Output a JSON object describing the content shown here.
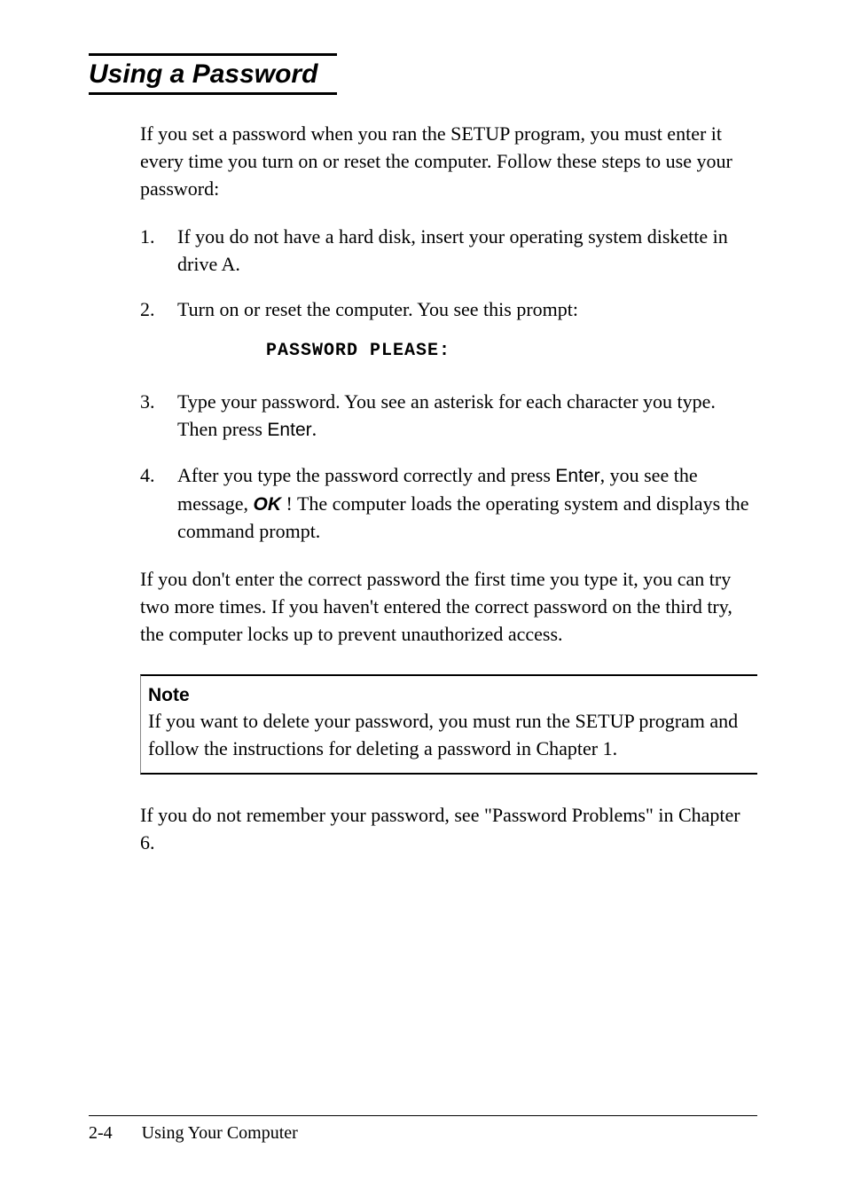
{
  "heading": "Using a Password",
  "intro": "If you set a password when you ran the SETUP program, you must enter it every time you turn on or reset the computer. Follow these steps to use your password:",
  "steps": {
    "n1": "1.",
    "s1": "If you do not have a hard disk, insert your operating system diskette in drive A.",
    "n2": "2.",
    "s2": "Turn on or reset the computer. You see this prompt:",
    "code": "PASSWORD PLEASE:",
    "n3": "3.",
    "s3a": "Type your password. You see an asterisk for each character you type. Then press ",
    "s3key": "Enter",
    "s3b": ".",
    "n4": "4.",
    "s4a": "After you type the password correctly and press ",
    "s4key": "Enter",
    "s4b": ", you see the message, ",
    "s4ok": "OK",
    "s4c": " ! The computer loads the operating system and displays the command prompt."
  },
  "paragraph_after": "If you don't enter the correct password the first time you type it, you can try two more times. If you haven't entered the correct password on the third try, the computer locks up to prevent unauthorized access.",
  "note": {
    "heading": "Note",
    "body": "If you want to delete your password, you must run the SETUP program and follow the instructions for deleting a password in Chapter 1."
  },
  "closing": "If you do not remember your password, see \"Password Problems\" in Chapter 6.",
  "footer": {
    "page": "2-4",
    "title": "Using Your Computer"
  }
}
